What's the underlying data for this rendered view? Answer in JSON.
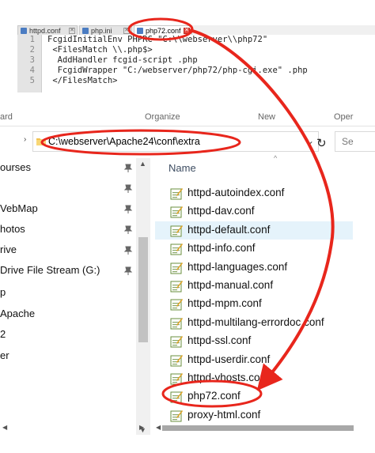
{
  "editor": {
    "tabs": [
      {
        "label": "httpd.conf",
        "active": false
      },
      {
        "label": "php.ini",
        "active": false
      },
      {
        "label": "php72.conf",
        "active": true
      }
    ],
    "tab_close_glyph": "✕",
    "lines": [
      {
        "num": "1",
        "text": "FcgidInitialEnv PHPRC \"C:\\\\webserver\\\\php72\""
      },
      {
        "num": "2",
        "text": " <FilesMatch \\\\.php$>"
      },
      {
        "num": "3",
        "text": "  AddHandler fcgid-script .php"
      },
      {
        "num": "4",
        "text": "  FcgidWrapper \"C:/webserver/php72/php-cgi.exe\" .php"
      },
      {
        "num": "5",
        "text": " </FilesMatch>"
      }
    ]
  },
  "ribbon": {
    "items": [
      "ard",
      "Organize",
      "New",
      "Oper"
    ]
  },
  "address_bar": {
    "path": "C:\\webserver\\Apache24\\conf\\extra",
    "dropdown_glyph": "⌄",
    "refresh_glyph": "↻",
    "search_placeholder": "Se",
    "left_chevron": "›"
  },
  "nav_pane": {
    "items": [
      {
        "label": "ourses",
        "pinned": true
      },
      {
        "label": "",
        "pinned": true
      },
      {
        "label": "VebMap",
        "pinned": true
      },
      {
        "label": "hotos",
        "pinned": true
      },
      {
        "label": "rive",
        "pinned": true
      },
      {
        "label": "Drive File Stream (G:)",
        "pinned": true
      },
      {
        "label": "p",
        "pinned": false
      },
      {
        "label": "Apache",
        "pinned": false
      },
      {
        "label": "2",
        "pinned": false
      },
      {
        "label": "er",
        "pinned": false
      }
    ],
    "scroll_up": "▲",
    "scroll_down": "▼",
    "hscroll_left": "◀",
    "hscroll_right": "▶"
  },
  "file_list": {
    "column_header": "Name",
    "sort_indicator": "^",
    "files": [
      {
        "name": "httpd-autoindex.conf",
        "selected": false
      },
      {
        "name": "httpd-dav.conf",
        "selected": false
      },
      {
        "name": "httpd-default.conf",
        "selected": true
      },
      {
        "name": "httpd-info.conf",
        "selected": false
      },
      {
        "name": "httpd-languages.conf",
        "selected": false
      },
      {
        "name": "httpd-manual.conf",
        "selected": false
      },
      {
        "name": "httpd-mpm.conf",
        "selected": false
      },
      {
        "name": "httpd-multilang-errordoc.conf",
        "selected": false
      },
      {
        "name": "httpd-ssl.conf",
        "selected": false
      },
      {
        "name": "httpd-userdir.conf",
        "selected": false
      },
      {
        "name": "httpd-vhosts.conf",
        "selected": false
      },
      {
        "name": "php72.conf",
        "selected": false
      },
      {
        "name": "proxy-html.conf",
        "selected": false
      }
    ],
    "hscroll_left": "◀"
  },
  "colors": {
    "annotation": "#e8261c",
    "selection": "#e5f3fb",
    "tab_close_active": "#e8473d"
  }
}
